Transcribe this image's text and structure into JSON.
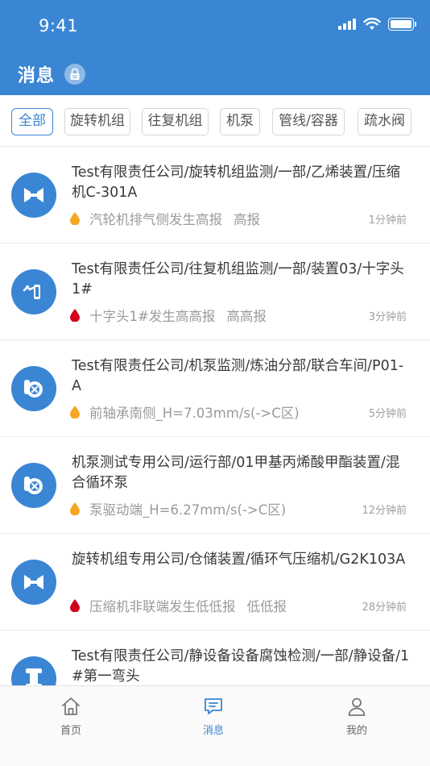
{
  "status_bar": {
    "time": "9:41"
  },
  "header": {
    "title": "消息"
  },
  "filters": [
    "全部",
    "旋转机组",
    "往复机组",
    "机泵",
    "管线/容器",
    "疏水阀"
  ],
  "messages": [
    {
      "icon": "rotating-unit-icon",
      "title": "Test有限责任公司/旋转机组监测/一部/乙烯装置/压缩机C-301A",
      "alert": "汽轮机排气侧发生高报",
      "level": "高报",
      "level_color": "#f5a623",
      "time": "1分钟前"
    },
    {
      "icon": "reciprocating-unit-icon",
      "title": "Test有限责任公司/往复机组监测/一部/装置03/十字头1#",
      "alert": "十字头1#发生高高报",
      "level": "高高报",
      "level_color": "#d0021b",
      "time": "3分钟前"
    },
    {
      "icon": "pump-icon",
      "title": "Test有限责任公司/机泵监测/炼油分部/联合车间/P01-A",
      "alert": "前轴承南侧_H=7.03mm/s(->C区)",
      "level": "",
      "level_color": "#f5a623",
      "time": "5分钟前"
    },
    {
      "icon": "pump-icon",
      "title": "机泵测试专用公司/运行部/01甲基丙烯酸甲酯装置/混合循环泵",
      "alert": "泵驱动端_H=6.27mm/s(->C区)",
      "level": "",
      "level_color": "#f5a623",
      "time": "12分钟前"
    },
    {
      "icon": "rotating-unit-icon",
      "title": "旋转机组专用公司/仓储装置/循环气压缩机/G2K103A",
      "alert": "压缩机非联端发生低低报",
      "level": "低低报",
      "level_color": "#d0021b",
      "time": "28分钟前"
    },
    {
      "icon": "pipeline-icon",
      "title": "Test有限责任公司/静设备设备腐蚀检测/一部/静设备/1#第一弯头",
      "alert": "",
      "level": "",
      "level_color": "#f5a623",
      "time": ""
    }
  ],
  "tabbar": {
    "home": "首页",
    "messages": "消息",
    "me": "我的"
  },
  "colors": {
    "primary": "#3a86d4",
    "warning": "#f5a623",
    "danger": "#d0021b"
  }
}
